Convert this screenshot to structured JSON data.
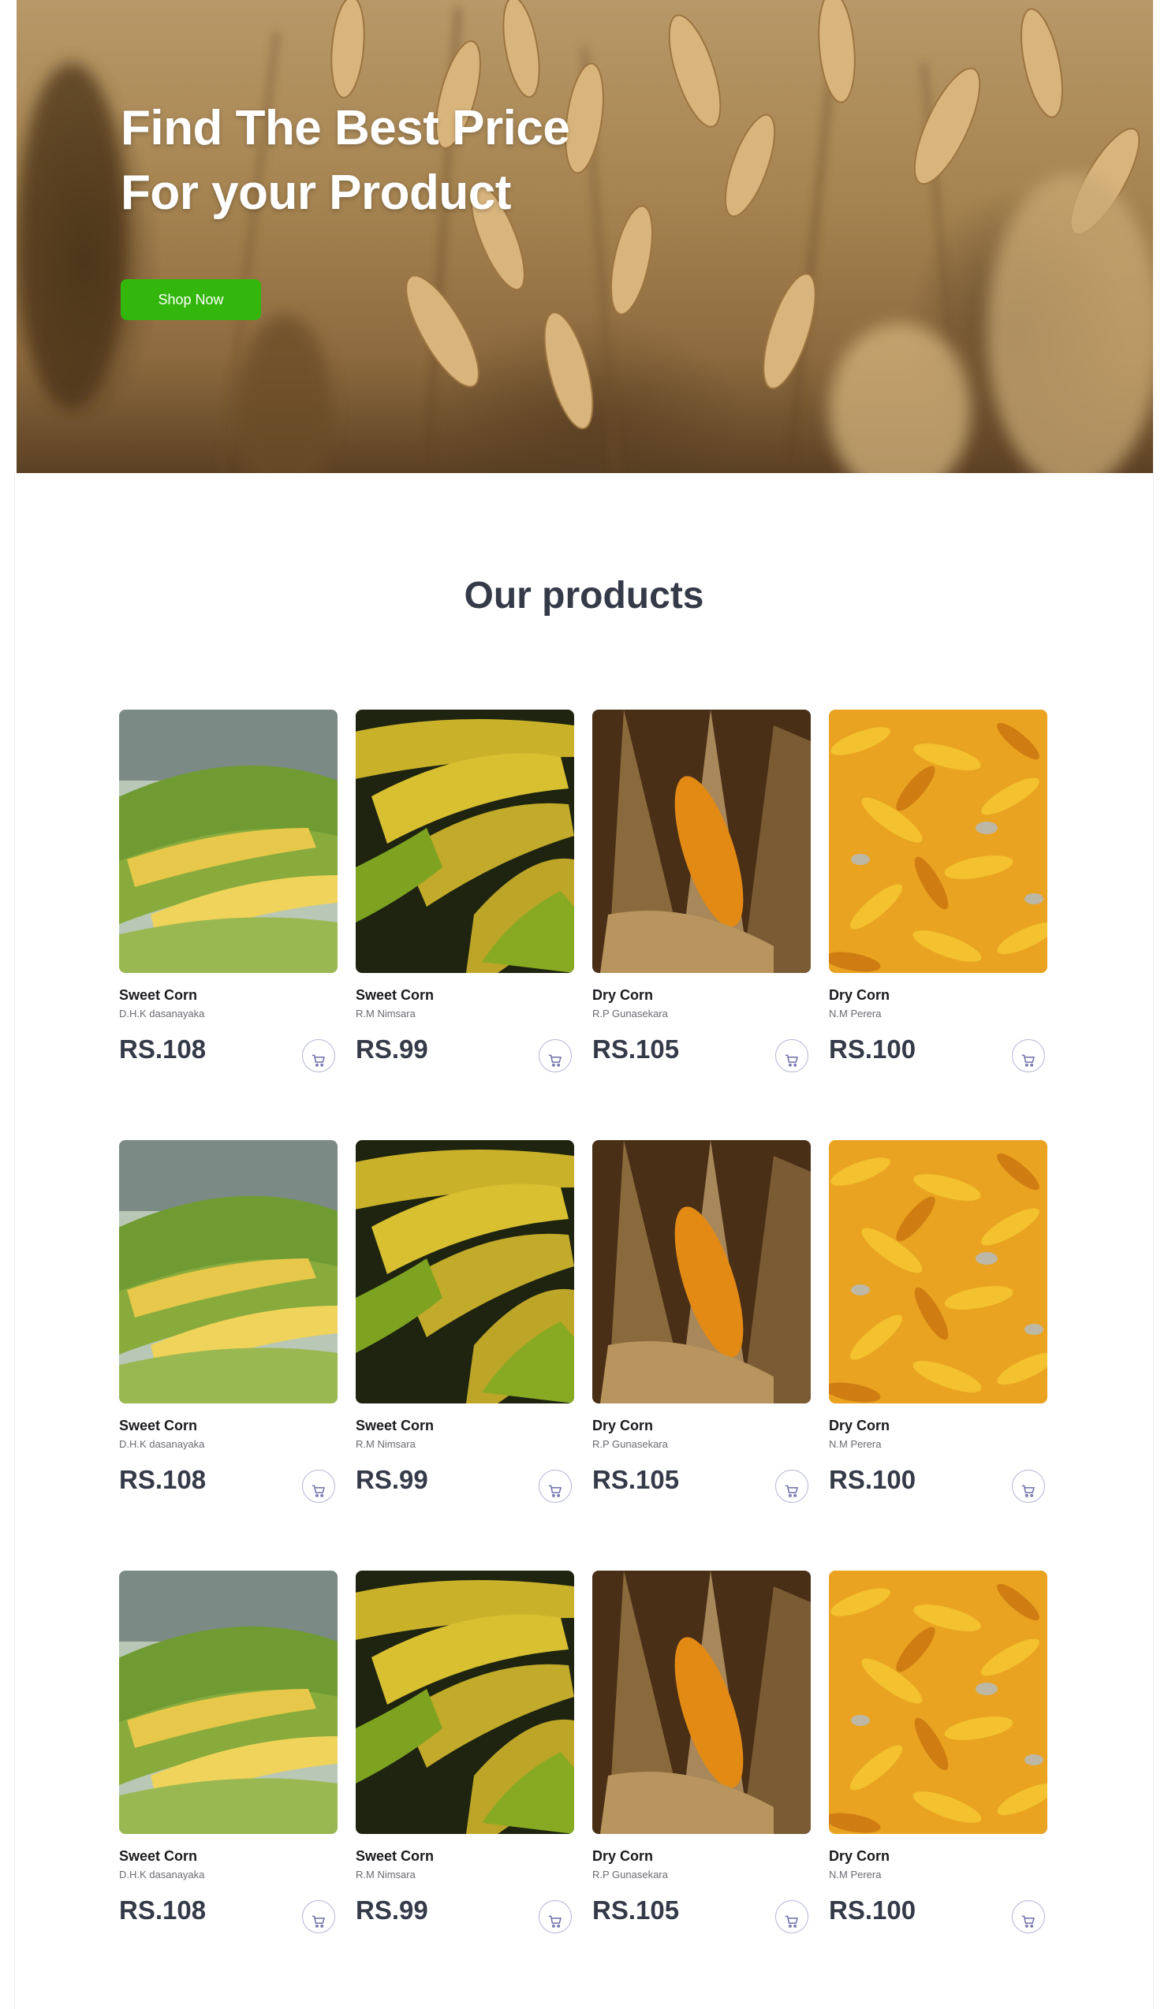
{
  "hero": {
    "title_line1": "Find The Best Price",
    "title_line2": "For your Product",
    "cta_label": "Shop Now"
  },
  "products_section": {
    "title": "Our products",
    "rows": [
      [
        {
          "name": "Sweet Corn",
          "seller": "D.H.K dasanayaka",
          "price": "RS.108",
          "image": "sweet-corn-husk-photo"
        },
        {
          "name": "Sweet Corn",
          "seller": "R.M Nimsara",
          "price": "RS.99",
          "image": "sweet-corn-cobs-photo"
        },
        {
          "name": "Dry Corn",
          "seller": "R.P Gunasekara",
          "price": "RS.105",
          "image": "dry-corn-husk-photo"
        },
        {
          "name": "Dry Corn",
          "seller": "N.M Perera",
          "price": "RS.100",
          "image": "dry-corn-pile-photo"
        }
      ],
      [
        {
          "name": "Sweet Corn",
          "seller": "D.H.K dasanayaka",
          "price": "RS.108",
          "image": "sweet-corn-husk-photo"
        },
        {
          "name": "Sweet Corn",
          "seller": "R.M Nimsara",
          "price": "RS.99",
          "image": "sweet-corn-cobs-photo"
        },
        {
          "name": "Dry Corn",
          "seller": "R.P Gunasekara",
          "price": "RS.105",
          "image": "dry-corn-husk-photo"
        },
        {
          "name": "Dry Corn",
          "seller": "N.M Perera",
          "price": "RS.100",
          "image": "dry-corn-pile-photo"
        }
      ],
      [
        {
          "name": "Sweet Corn",
          "seller": "D.H.K dasanayaka",
          "price": "RS.108",
          "image": "sweet-corn-husk-photo"
        },
        {
          "name": "Sweet Corn",
          "seller": "R.M Nimsara",
          "price": "RS.99",
          "image": "sweet-corn-cobs-photo"
        },
        {
          "name": "Dry Corn",
          "seller": "R.P Gunasekara",
          "price": "RS.105",
          "image": "dry-corn-husk-photo"
        },
        {
          "name": "Dry Corn",
          "seller": "N.M Perera",
          "price": "RS.100",
          "image": "dry-corn-pile-photo"
        }
      ]
    ],
    "cart_icon": "cart-icon"
  },
  "colors": {
    "accent_green": "#33b70c",
    "heading_dark": "#343a48",
    "cart_ring": "#b4b6d6",
    "cart_icon": "#6d6fa8"
  }
}
